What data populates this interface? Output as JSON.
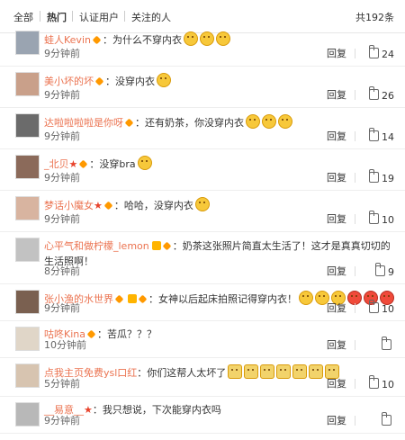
{
  "tabs": {
    "all": "全部",
    "hot": "热门",
    "verified": "认证用户",
    "following": "关注的人",
    "count": "共192条"
  },
  "labels": {
    "reply": "回复"
  },
  "comments": [
    {
      "user": "蛙人Kevin",
      "badges": [
        "diamond"
      ],
      "text": "：为什么不穿内衣",
      "emojis": 3,
      "emoji_style": "laugh",
      "time": "9分钟前",
      "likes": "24"
    },
    {
      "user": "美小坏的坏",
      "badges": [
        "diamond"
      ],
      "text": "：没穿内衣",
      "emojis": 1,
      "emoji_style": "laugh",
      "time": "9分钟前",
      "likes": "26"
    },
    {
      "user": "达啦啦啦啦是你呀",
      "badges": [
        "diamond"
      ],
      "text": "：还有奶茶，你没穿内衣",
      "emojis": 3,
      "emoji_style": "laugh",
      "time": "9分钟前",
      "likes": "14"
    },
    {
      "user": "_北贝",
      "badges": [
        "star",
        "diamond"
      ],
      "text": "：没穿bra",
      "emojis": 1,
      "emoji_style": "laugh",
      "time": "9分钟前",
      "likes": "19"
    },
    {
      "user": "梦话小魔女",
      "badges": [
        "star",
        "diamond"
      ],
      "text": "：哈哈，没穿内衣",
      "emojis": 1,
      "emoji_style": "laugh",
      "time": "9分钟前",
      "likes": "10"
    },
    {
      "user": "心平气和做柠檬_lemon",
      "badges": [
        "vip",
        "diamond"
      ],
      "text": "：奶茶这张照片简直太生活了！这才是真真切切的生活照啊！",
      "emojis": 0,
      "time": "8分钟前",
      "likes": "9"
    },
    {
      "user": "张小渔的水世界",
      "badges": [
        "diamond",
        "vip",
        "diamond"
      ],
      "text": "：女神以后起床拍照记得穿内衣！",
      "emojis": 6,
      "emoji_style": "mix",
      "time": "9分钟前",
      "likes": "10"
    },
    {
      "user": "咕咚Kina",
      "badges": [
        "diamond"
      ],
      "text": "：苦瓜？？？",
      "emojis": 0,
      "time": "10分钟前",
      "likes": ""
    },
    {
      "user": "点我主页免费ysl口红",
      "badges": [],
      "text": "：你们这帮人太坏了",
      "emojis": 7,
      "emoji_style": "cat",
      "time": "5分钟前",
      "likes": "10"
    },
    {
      "user": "__易意__",
      "badges": [
        "star"
      ],
      "text": "：我只想说，下次能穿内衣吗",
      "emojis": 0,
      "time": "9分钟前",
      "likes": ""
    }
  ]
}
